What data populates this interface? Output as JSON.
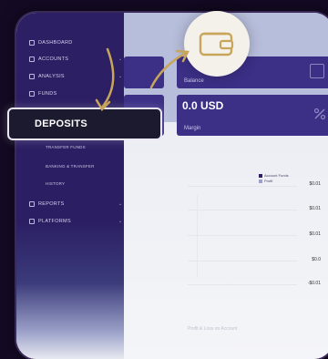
{
  "sidebar": {
    "items": [
      {
        "label": "DASHBOARD",
        "icon": "dashboard-icon"
      },
      {
        "label": "ACCOUNTS",
        "icon": "accounts-icon"
      },
      {
        "label": "ANALYSIS",
        "icon": "analysis-icon"
      },
      {
        "label": "FUNDS",
        "icon": "funds-icon"
      }
    ],
    "sub_items": [
      "TRANSFER FUNDS",
      "BANKING & TRANSFER",
      "HISTORY"
    ],
    "lower_items": [
      {
        "label": "REPORTS",
        "icon": "reports-icon"
      },
      {
        "label": "PLATFORMS",
        "icon": "platforms-icon"
      }
    ]
  },
  "callout": {
    "label": "DEPOSITS"
  },
  "cards": {
    "balance_sub": "Balance",
    "amount": "0.0 USD",
    "amount_sub": "Margin"
  },
  "legend": {
    "items": [
      "Account Funds",
      "Profit"
    ]
  },
  "axis": {
    "ticks": [
      "$0.01",
      "$0.01",
      "$0.01",
      "$0.0",
      "-$0.01"
    ]
  },
  "footer": {
    "text": "Profit & Loss on Account"
  },
  "colors": {
    "sidebar": "#2c1f63",
    "accent_gold": "#c7a55a",
    "card": "#3b2f86"
  }
}
